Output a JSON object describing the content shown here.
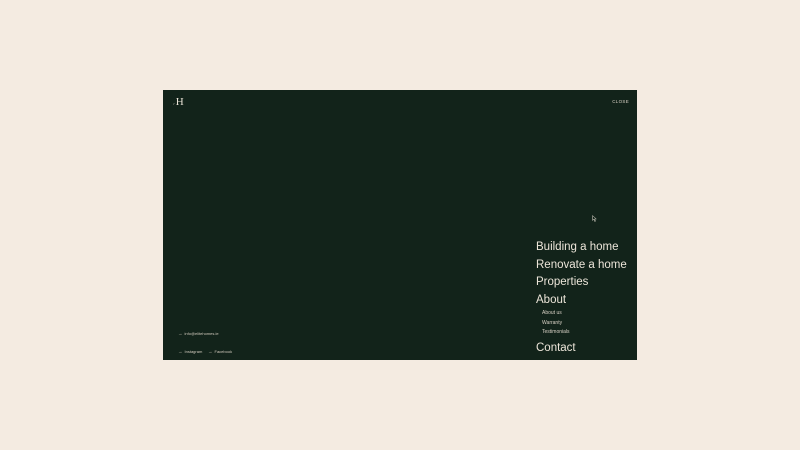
{
  "logo": {
    "mark": "ᐟ",
    "letter": "H"
  },
  "header": {
    "close_label": "CLOSE"
  },
  "nav": {
    "items": [
      {
        "label": "Building a home"
      },
      {
        "label": "Renovate a home"
      },
      {
        "label": "Properties"
      },
      {
        "label": "About"
      }
    ],
    "about_sub": [
      {
        "label": "About us"
      },
      {
        "label": "Warranty"
      },
      {
        "label": "Testimonials"
      }
    ],
    "contact_label": "Contact"
  },
  "footer": {
    "email": "info@elitehomes.ie",
    "instagram": "Instagram",
    "facebook": "Facebook",
    "arrow_glyph": "→"
  },
  "colors": {
    "page_background": "#f4ebe1",
    "panel_background": "#12231a",
    "text_primary": "#ece5d9"
  }
}
